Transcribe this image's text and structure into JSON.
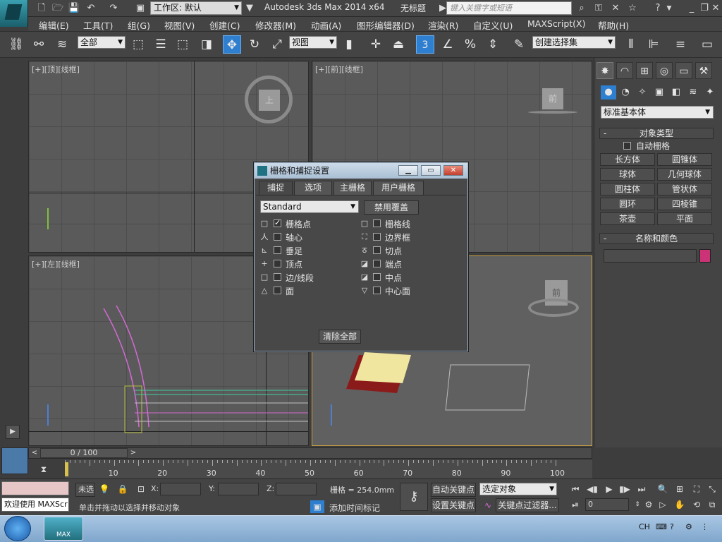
{
  "titlebar": {
    "workspace_label": "工作区: 默认",
    "app_title": "Autodesk 3ds Max  2014 x64",
    "doc_title": "无标题",
    "search_placeholder": "键入关键字或短语"
  },
  "menubar": [
    "编辑(E)",
    "工具(T)",
    "组(G)",
    "视图(V)",
    "创建(C)",
    "修改器(M)",
    "动画(A)",
    "图形编辑器(D)",
    "渲染(R)",
    "自定义(U)",
    "MAXScript(X)",
    "帮助(H)"
  ],
  "toolbar": {
    "selection_filter": "全部",
    "ref_coord": "视图",
    "snap_number": "3",
    "selection_set_placeholder": "创建选择集"
  },
  "viewports": {
    "top": "[+][顶][线框]",
    "front": "[+][前][线框]",
    "left": "[+][左][线框]",
    "viewcube_top": "上",
    "viewcube_front": "前",
    "viewcube_persp": "前"
  },
  "command_panel": {
    "category": "标准基本体",
    "object_type_title": "对象类型",
    "autogrid_label": "自动栅格",
    "objects": [
      "长方体",
      "圆锥体",
      "球体",
      "几何球体",
      "圆柱体",
      "管状体",
      "圆环",
      "四棱锥",
      "茶壶",
      "平面"
    ],
    "name_color_title": "名称和颜色",
    "accent_color": "#cc3377"
  },
  "dialog": {
    "title": "栅格和捕捉设置",
    "tabs": [
      "捕捉",
      "选项",
      "主栅格",
      "用户栅格"
    ],
    "preset": "Standard",
    "override_button": "禁用覆盖",
    "left_snaps": [
      {
        "icon": "□",
        "label": "栅格点",
        "checked": true
      },
      {
        "icon": "人",
        "label": "轴心",
        "checked": false
      },
      {
        "icon": "⊾",
        "label": "垂足",
        "checked": false
      },
      {
        "icon": "+",
        "label": "顶点",
        "checked": false
      },
      {
        "icon": "□",
        "label": "边/线段",
        "checked": false
      },
      {
        "icon": "△",
        "label": "面",
        "checked": false
      }
    ],
    "right_snaps": [
      {
        "icon": "□",
        "label": "栅格线",
        "checked": false
      },
      {
        "icon": "⛶",
        "label": "边界框",
        "checked": false
      },
      {
        "icon": "ठ",
        "label": "切点",
        "checked": false
      },
      {
        "icon": "◪",
        "label": "端点",
        "checked": false
      },
      {
        "icon": "◪",
        "label": "中点",
        "checked": false
      },
      {
        "icon": "▽",
        "label": "中心面",
        "checked": false
      }
    ],
    "clear_button": "清除全部"
  },
  "timeline": {
    "frame_counter": "0 / 100",
    "ticks": [
      "10",
      "20",
      "30",
      "40",
      "50",
      "60",
      "70",
      "80",
      "90",
      "100"
    ]
  },
  "statusbar": {
    "maxscript_text": "欢迎使用 MAXScr",
    "unselected": "未选",
    "x_label": "X:",
    "y_label": "Y:",
    "z_label": "Z:",
    "grid_value": "栅格 = 254.0mm",
    "prompt": "单击并拖动以选择并移动对象",
    "add_time_tag": "添加时间标记",
    "auto_key": "自动关键点",
    "set_key": "设置关键点",
    "key_mode": "选定对象",
    "key_filters": "关键点过滤器...",
    "current_frame": "0"
  },
  "taskbar": {
    "app_label": "MAX",
    "lang": "CH"
  }
}
